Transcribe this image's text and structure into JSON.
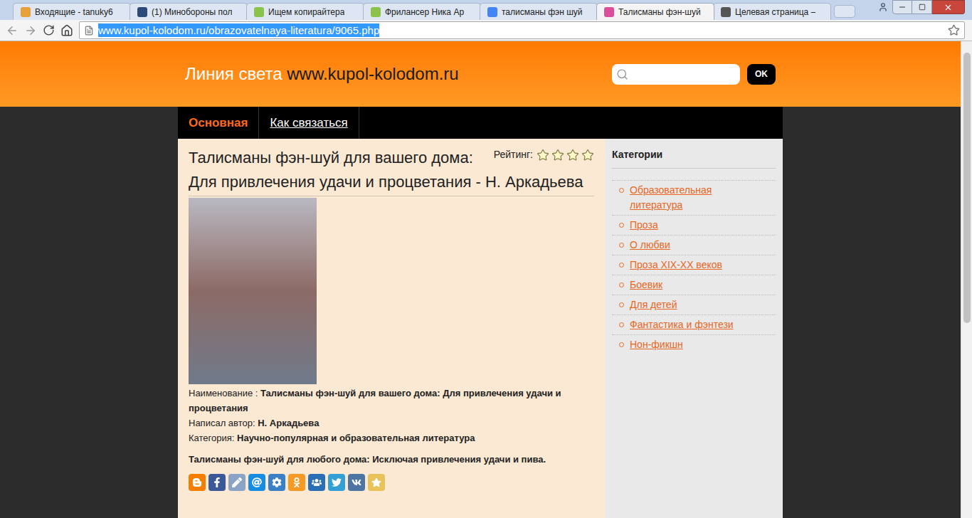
{
  "browser": {
    "tabs": [
      {
        "label": "Входящие - tanuky6",
        "selected": false,
        "color": "#e8a13a"
      },
      {
        "label": "(1) Минобороны пол",
        "selected": false,
        "color": "#2b4a7a"
      },
      {
        "label": "Ищем копирайтера",
        "selected": false,
        "color": "#8bc34a"
      },
      {
        "label": "Фрилансер Ника Ар",
        "selected": false,
        "color": "#8bc34a"
      },
      {
        "label": "талисманы фэн шуй",
        "selected": false,
        "color": "#4285f4"
      },
      {
        "label": "Талисманы фэн-шуй",
        "selected": true,
        "color": "#d94f9a"
      },
      {
        "label": "Целевая страница –",
        "selected": false,
        "color": "#555555"
      }
    ],
    "address": {
      "url": "www.kupol-kolodom.ru/obrazovatelnaya-literatura/9065.php",
      "selected": true
    }
  },
  "site": {
    "logo": {
      "name": "Линия света",
      "domain": "www.kupol-kolodom.ru"
    },
    "search": {
      "button": "OK"
    },
    "nav": [
      {
        "label": "Основная",
        "selected": true
      },
      {
        "label": "Как связаться",
        "selected": false
      }
    ]
  },
  "book": {
    "title": "Талисманы фэн-шуй для вашего дома: Для привлечения удачи и процветания - Н. Аркадьева",
    "rating": {
      "label": "Рейтинг:",
      "stars": 0,
      "max": 4
    },
    "fields": [
      {
        "label": "Наименование :",
        "value": "Талисманы фэн-шуй для вашего дома: Для привлечения удачи и процветания"
      },
      {
        "label": "Написал автор:",
        "value": "Н. Аркадьева"
      },
      {
        "label": "Категория:",
        "value": "Научно-популярная и образовательная литература"
      }
    ],
    "description": "Талисманы фэн-шуй для любого дома: Исключая привлечения удачи и пива.",
    "share_buttons": [
      {
        "color": "#f57d00"
      },
      {
        "color": "#3b5998"
      },
      {
        "color": "#8aa3c7"
      },
      {
        "color": "#168de2"
      },
      {
        "color": "#3b80c6"
      },
      {
        "color": "#f59a24"
      },
      {
        "color": "#2a6fb5"
      },
      {
        "color": "#33a0d5"
      },
      {
        "color": "#4c75a3"
      },
      {
        "color": "#e8c25a"
      }
    ]
  },
  "sidebar": {
    "title": "Категории",
    "items": [
      "Образовательная литература",
      "Проза",
      "О любви",
      "Проза XIX-XX веков",
      "Боевик",
      "Для детей",
      "Фантастика и фэнтези",
      "Нон-фикшн"
    ]
  }
}
